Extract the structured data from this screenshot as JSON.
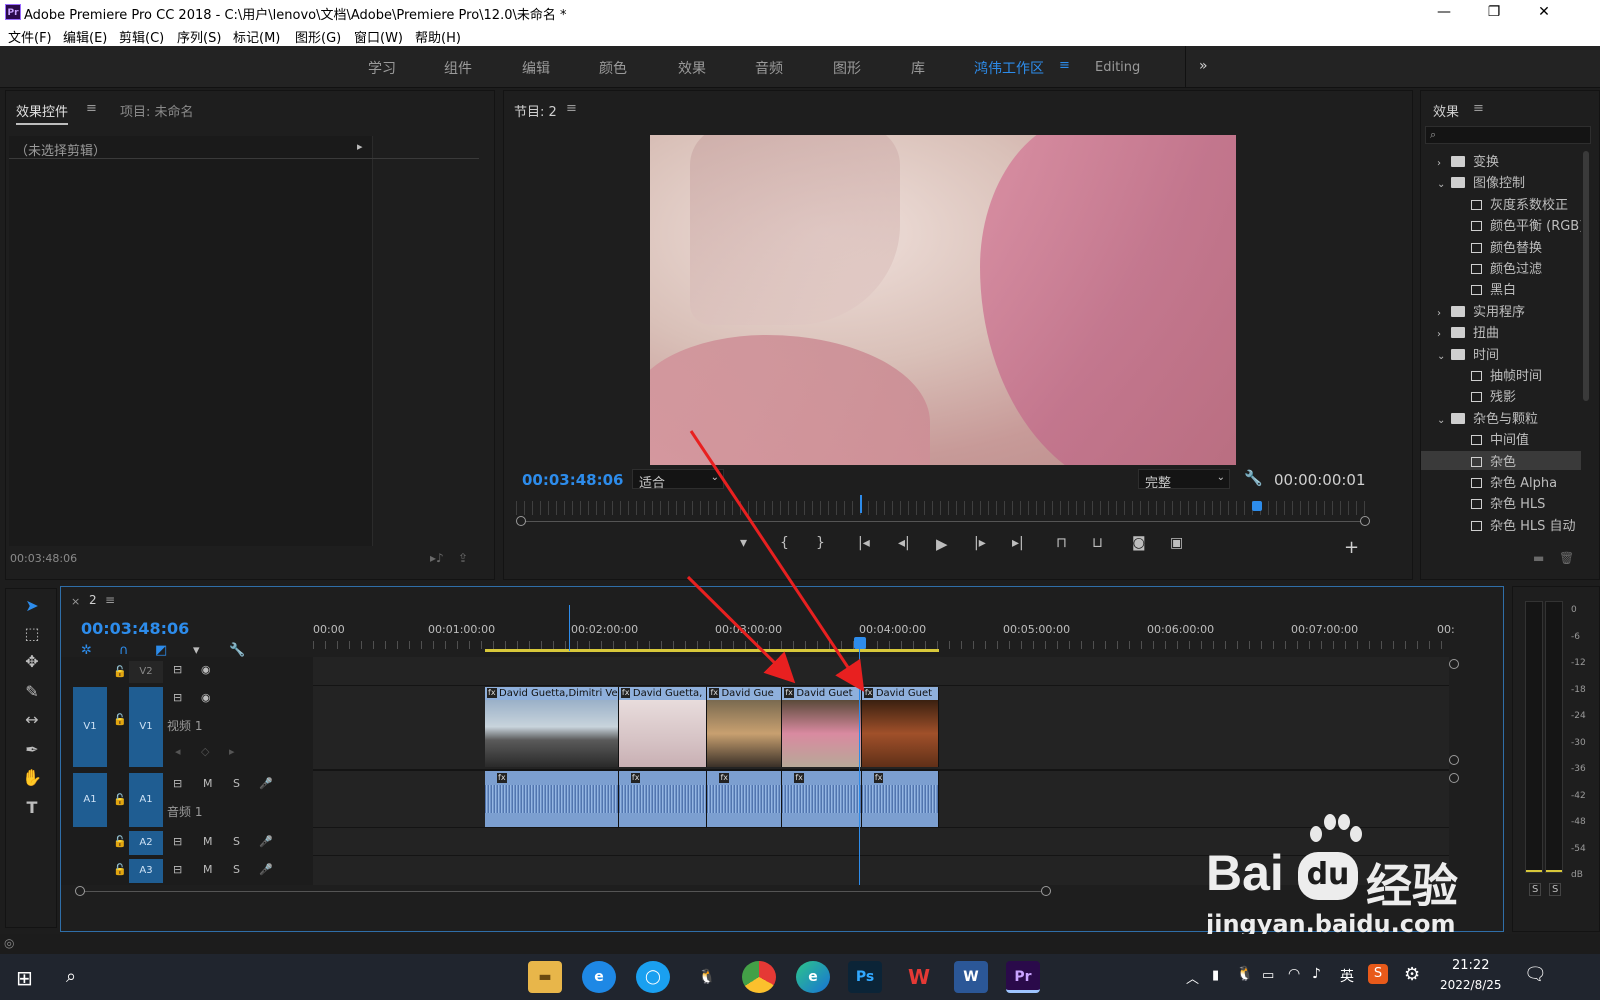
{
  "titlebar": {
    "icon": "Pr",
    "title": "Adobe Premiere Pro CC 2018 - C:\\用户\\lenovo\\文档\\Adobe\\Premiere Pro\\12.0\\未命名 *",
    "minimize": "—",
    "restore": "❐",
    "close": "✕"
  },
  "menu": [
    "文件(F)",
    "编辑(E)",
    "剪辑(C)",
    "序列(S)",
    "标记(M)",
    "图形(G)",
    "窗口(W)",
    "帮助(H)"
  ],
  "workspaces": {
    "tabs": [
      "学习",
      "组件",
      "编辑",
      "颜色",
      "效果",
      "音频",
      "图形",
      "库",
      "鸿伟工作区",
      "Editing"
    ],
    "active": "鸿伟工作区",
    "more": "»",
    "menu_glyph": "≡"
  },
  "effect_controls": {
    "tab": "效果控件",
    "project_tab": "项目: 未命名",
    "menu_glyph": "≡",
    "no_clip": "（未选择剪辑）",
    "expand_glyph": "▸",
    "timecode": "00:03:48:06"
  },
  "program": {
    "tab": "节目: 2",
    "menu_glyph": "≡",
    "timecode": "00:03:48:06",
    "fit": "适合",
    "quality": "完整",
    "duration": "00:00:00:01",
    "add_glyph": "+"
  },
  "effects": {
    "tab": "效果",
    "menu_glyph": "≡",
    "search_placeholder": "",
    "tree": [
      {
        "type": "folder",
        "label": "变换",
        "open": false
      },
      {
        "type": "folder",
        "label": "图像控制",
        "open": true
      },
      {
        "type": "item",
        "label": "灰度系数校正"
      },
      {
        "type": "item",
        "label": "颜色平衡 (RGB)"
      },
      {
        "type": "item",
        "label": "颜色替换"
      },
      {
        "type": "item",
        "label": "颜色过滤"
      },
      {
        "type": "item",
        "label": "黑白"
      },
      {
        "type": "folder",
        "label": "实用程序",
        "open": false
      },
      {
        "type": "folder",
        "label": "扭曲",
        "open": false
      },
      {
        "type": "folder",
        "label": "时间",
        "open": true
      },
      {
        "type": "item",
        "label": "抽帧时间"
      },
      {
        "type": "item",
        "label": "残影"
      },
      {
        "type": "folder",
        "label": "杂色与颗粒",
        "open": true
      },
      {
        "type": "item",
        "label": "中间值"
      },
      {
        "type": "item",
        "label": "杂色",
        "selected": true
      },
      {
        "type": "item",
        "label": "杂色 Alpha"
      },
      {
        "type": "item",
        "label": "杂色 HLS"
      },
      {
        "type": "item",
        "label": "杂色 HLS 自动"
      }
    ]
  },
  "timeline": {
    "close": "×",
    "sequence": "2",
    "menu_glyph": "≡",
    "timecode": "00:03:48:06",
    "ruler": [
      "00:00",
      "00:01:00:00",
      "00:02:00:00",
      "00:03:00:00",
      "00:04:00:00",
      "00:05:00:00",
      "00:06:00:00",
      "00:07:00:00",
      "00:"
    ],
    "tracks": {
      "v2": "V2",
      "v1": "V1",
      "v1_src": "V1",
      "v1_name": "视频 1",
      "a1": "A1",
      "a1_src": "A1",
      "a1_name": "音频 1",
      "a2": "A2",
      "a3": "A3",
      "m": "M",
      "s": "S"
    },
    "clips": [
      {
        "label": "David Guetta,Dimitri Vegas",
        "start": 0.0,
        "end": 0.295
      },
      {
        "label": "David Guetta,",
        "start": 0.295,
        "end": 0.49
      },
      {
        "label": "David Gue",
        "start": 0.49,
        "end": 0.655
      },
      {
        "label": "David Guet",
        "start": 0.655,
        "end": 0.83
      },
      {
        "label": "David Guet",
        "start": 0.83,
        "end": 1.0
      }
    ],
    "fx_badge": "fx"
  },
  "meters": {
    "labels": [
      "0",
      "-6",
      "-12",
      "-18",
      "-24",
      "-30",
      "-36",
      "-42",
      "-48",
      "-54",
      "dB"
    ],
    "solo": [
      "S",
      "S"
    ]
  },
  "watermark": {
    "brand": "Bai",
    "du": "du",
    "cn": "经验",
    "url": "jingyan.baidu.com"
  },
  "taskbar": {
    "time": "21:22",
    "date": "2022/8/25",
    "ime": "英"
  }
}
